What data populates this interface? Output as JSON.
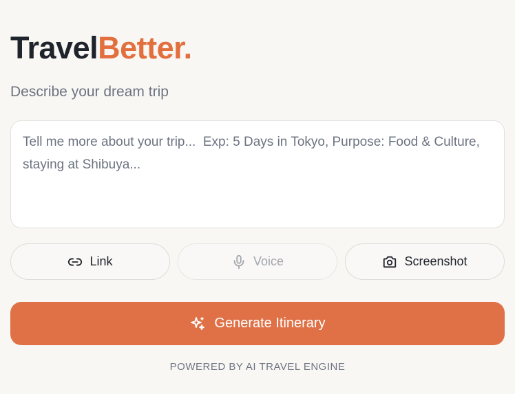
{
  "brand": {
    "part1": "Travel",
    "part2": "Better",
    "dot": ".",
    "accent_color": "#e2703f"
  },
  "subtitle": "Describe your dream trip",
  "trip_input": {
    "value": "",
    "placeholder": "Tell me more about your trip...  Exp: 5 Days in Tokyo, Purpose: Food & Culture, staying at Shibuya..."
  },
  "actions": {
    "link": {
      "label": "Link",
      "icon": "link-icon"
    },
    "voice": {
      "label": "Voice",
      "icon": "microphone-icon",
      "disabled": true
    },
    "screenshot": {
      "label": "Screenshot",
      "icon": "camera-icon"
    }
  },
  "generate": {
    "label": "Generate Itinerary",
    "icon": "sparkle-icon",
    "color": "#e07147"
  },
  "footer": "POWERED BY AI TRAVEL ENGINE"
}
